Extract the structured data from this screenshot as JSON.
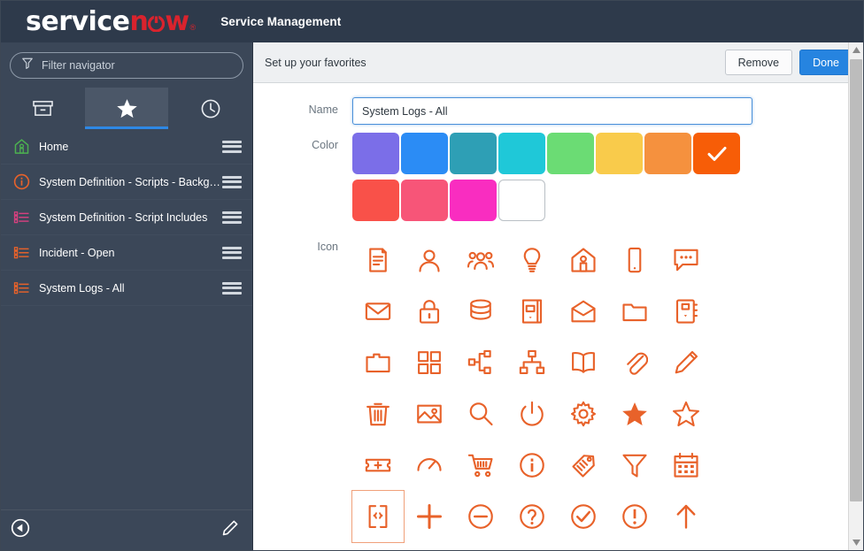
{
  "banner": {
    "logo_service": "service",
    "logo_now": "now",
    "trademark": "®",
    "title": "Service Management"
  },
  "sidebar": {
    "filter": {
      "placeholder": "Filter navigator",
      "icon": "funnel-icon"
    },
    "tabs": [
      {
        "name": "all-applications",
        "icon": "box-icon",
        "active": false
      },
      {
        "name": "favorites",
        "icon": "star-icon",
        "active": true
      },
      {
        "name": "history",
        "icon": "clock-icon",
        "active": false
      }
    ],
    "favorites": [
      {
        "label": "Home",
        "icon": "home-icon",
        "color": "#4caf50"
      },
      {
        "label": "System Definition - Scripts - Backgr…",
        "icon": "info-circle-icon",
        "color": "#e8622a"
      },
      {
        "label": "System Definition - Script Includes",
        "icon": "list-icon",
        "color": "#d6407f"
      },
      {
        "label": "Incident - Open",
        "icon": "list-icon",
        "color": "#e8622a"
      },
      {
        "label": "System Logs - All",
        "icon": "list-icon",
        "color": "#e8622a"
      }
    ],
    "footer": {
      "collapse": "collapse-left-icon",
      "edit": "pencil-icon"
    }
  },
  "panel": {
    "title": "Set up your favorites",
    "remove_label": "Remove",
    "done_label": "Done"
  },
  "form": {
    "name_label": "Name",
    "name_value": "System Logs - All",
    "color_label": "Color",
    "icon_label": "Icon",
    "colors": [
      {
        "name": "purple",
        "hex": "#7b6ee8",
        "selected": false
      },
      {
        "name": "blue",
        "hex": "#2b8cf5",
        "selected": false
      },
      {
        "name": "teal",
        "hex": "#2e9fb5",
        "selected": false
      },
      {
        "name": "cyan",
        "hex": "#1fc8d8",
        "selected": false
      },
      {
        "name": "green",
        "hex": "#6bdc74",
        "selected": false
      },
      {
        "name": "yellow",
        "hex": "#f9cb4b",
        "selected": false
      },
      {
        "name": "orange",
        "hex": "#f5913e",
        "selected": false
      },
      {
        "name": "deep-orange",
        "hex": "#f75d07",
        "selected": true
      },
      {
        "name": "red",
        "hex": "#f95149",
        "selected": false
      },
      {
        "name": "pink",
        "hex": "#f75578",
        "selected": false
      },
      {
        "name": "magenta",
        "hex": "#f92dc0",
        "selected": false
      },
      {
        "name": "white",
        "hex": "#ffffff",
        "selected": false
      }
    ],
    "icon_color": "#e8622a",
    "icons": [
      {
        "name": "document-icon",
        "selected": false
      },
      {
        "name": "person-icon",
        "selected": false
      },
      {
        "name": "group-icon",
        "selected": false
      },
      {
        "name": "lightbulb-icon",
        "selected": false
      },
      {
        "name": "home-icon",
        "selected": false
      },
      {
        "name": "mobile-phone-icon",
        "selected": false
      },
      {
        "name": "chat-bubble-icon",
        "selected": false
      },
      {
        "name": "envelope-icon",
        "selected": false
      },
      {
        "name": "lock-icon",
        "selected": false
      },
      {
        "name": "database-icon",
        "selected": false
      },
      {
        "name": "kiosk-icon",
        "selected": false
      },
      {
        "name": "inbox-icon",
        "selected": false
      },
      {
        "name": "folder-icon",
        "selected": false
      },
      {
        "name": "address-book-icon",
        "selected": false
      },
      {
        "name": "folder-open-icon",
        "selected": false
      },
      {
        "name": "grid-apps-icon",
        "selected": false
      },
      {
        "name": "sitemap-icon",
        "selected": false
      },
      {
        "name": "hierarchy-icon",
        "selected": false
      },
      {
        "name": "open-book-icon",
        "selected": false
      },
      {
        "name": "paperclip-icon",
        "selected": false
      },
      {
        "name": "pencil-icon",
        "selected": false
      },
      {
        "name": "trash-icon",
        "selected": false
      },
      {
        "name": "image-icon",
        "selected": false
      },
      {
        "name": "magnifier-icon",
        "selected": false
      },
      {
        "name": "power-icon",
        "selected": false
      },
      {
        "name": "gear-icon",
        "selected": false
      },
      {
        "name": "star-filled-icon",
        "selected": false
      },
      {
        "name": "star-outline-icon",
        "selected": false
      },
      {
        "name": "ticket-add-icon",
        "selected": false
      },
      {
        "name": "gauge-icon",
        "selected": false
      },
      {
        "name": "shopping-cart-icon",
        "selected": false
      },
      {
        "name": "info-circle-icon",
        "selected": false
      },
      {
        "name": "tag-icon",
        "selected": false
      },
      {
        "name": "funnel-icon",
        "selected": false
      },
      {
        "name": "calendar-icon",
        "selected": false
      },
      {
        "name": "code-braces-icon",
        "selected": true
      },
      {
        "name": "plus-icon",
        "selected": false
      },
      {
        "name": "minus-circle-icon",
        "selected": false
      },
      {
        "name": "question-circle-icon",
        "selected": false
      },
      {
        "name": "check-circle-icon",
        "selected": false
      },
      {
        "name": "exclamation-circle-icon",
        "selected": false
      },
      {
        "name": "arrow-up-icon",
        "selected": false
      }
    ]
  }
}
